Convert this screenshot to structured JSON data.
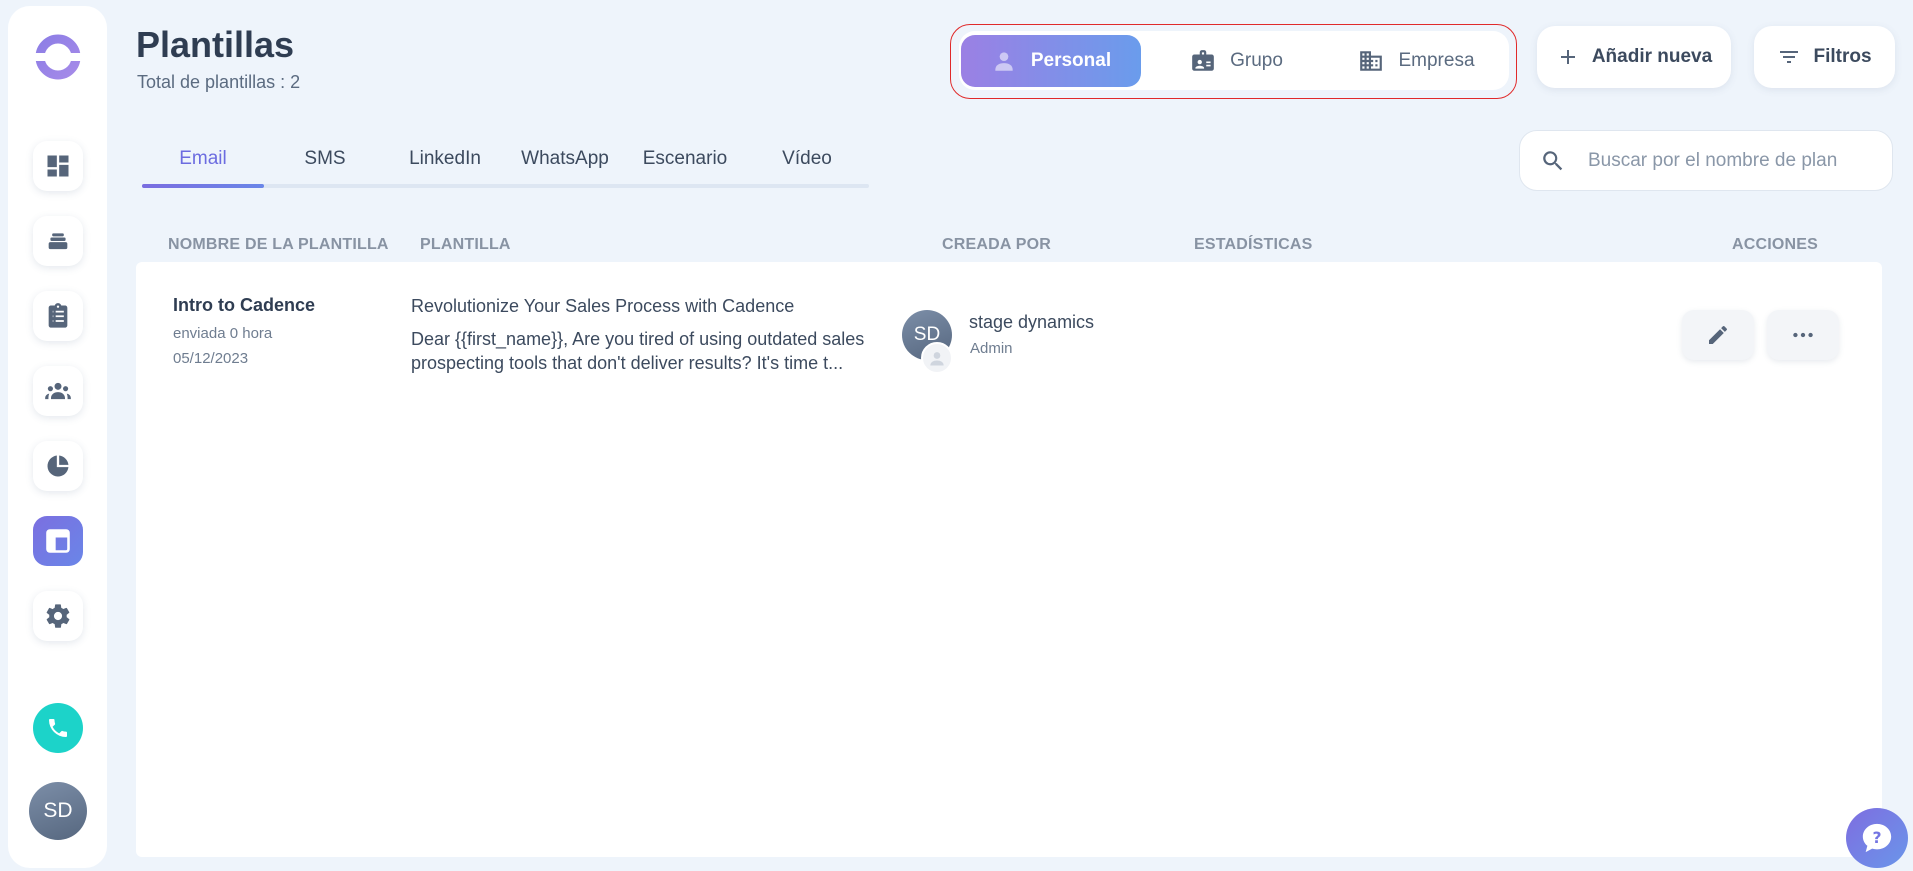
{
  "header": {
    "title": "Plantillas",
    "subtitle": "Total de plantillas : 2"
  },
  "scope": {
    "options": [
      {
        "label": "Personal",
        "icon": "user-icon",
        "active": true
      },
      {
        "label": "Grupo",
        "icon": "id-card-icon",
        "active": false
      },
      {
        "label": "Empresa",
        "icon": "building-icon",
        "active": false
      }
    ]
  },
  "actions": {
    "add_label": "Añadir nueva",
    "filter_label": "Filtros"
  },
  "tabs": [
    {
      "label": "Email",
      "active": true
    },
    {
      "label": "SMS",
      "active": false
    },
    {
      "label": "LinkedIn",
      "active": false
    },
    {
      "label": "WhatsApp",
      "active": false
    },
    {
      "label": "Escenario",
      "active": false
    },
    {
      "label": "Vídeo",
      "active": false
    }
  ],
  "search": {
    "placeholder": "Buscar por el nombre de plan",
    "value": ""
  },
  "table": {
    "columns": [
      "NOMBRE DE LA PLANTILLA",
      "PLANTILLA",
      "CREADA POR",
      "ESTADÍSTICAS",
      "ACCIONES"
    ],
    "rows": [
      {
        "name": "Intro to Cadence",
        "sent": "enviada 0 hora",
        "date": "05/12/2023",
        "subject": "Revolutionize Your Sales Process with Cadence",
        "body": "Dear {{first_name}},   Are you tired of using outdated sales prospecting tools that don't deliver results? It's time t...",
        "creator": {
          "initials": "SD",
          "name": "stage dynamics",
          "role": "Admin"
        }
      }
    ]
  },
  "sidebar": {
    "items": [
      {
        "icon": "dashboard-icon",
        "active": false
      },
      {
        "icon": "layers-icon",
        "active": false
      },
      {
        "icon": "clipboard-icon",
        "active": false
      },
      {
        "icon": "people-icon",
        "active": false
      },
      {
        "icon": "pie-chart-icon",
        "active": false
      },
      {
        "icon": "templates-icon",
        "active": true
      },
      {
        "icon": "gear-icon",
        "active": false
      }
    ],
    "avatar_initials": "SD"
  },
  "colors": {
    "accent": "#6c6ce0",
    "call": "#1cd3c9",
    "highlight_border": "#e02a2a"
  }
}
